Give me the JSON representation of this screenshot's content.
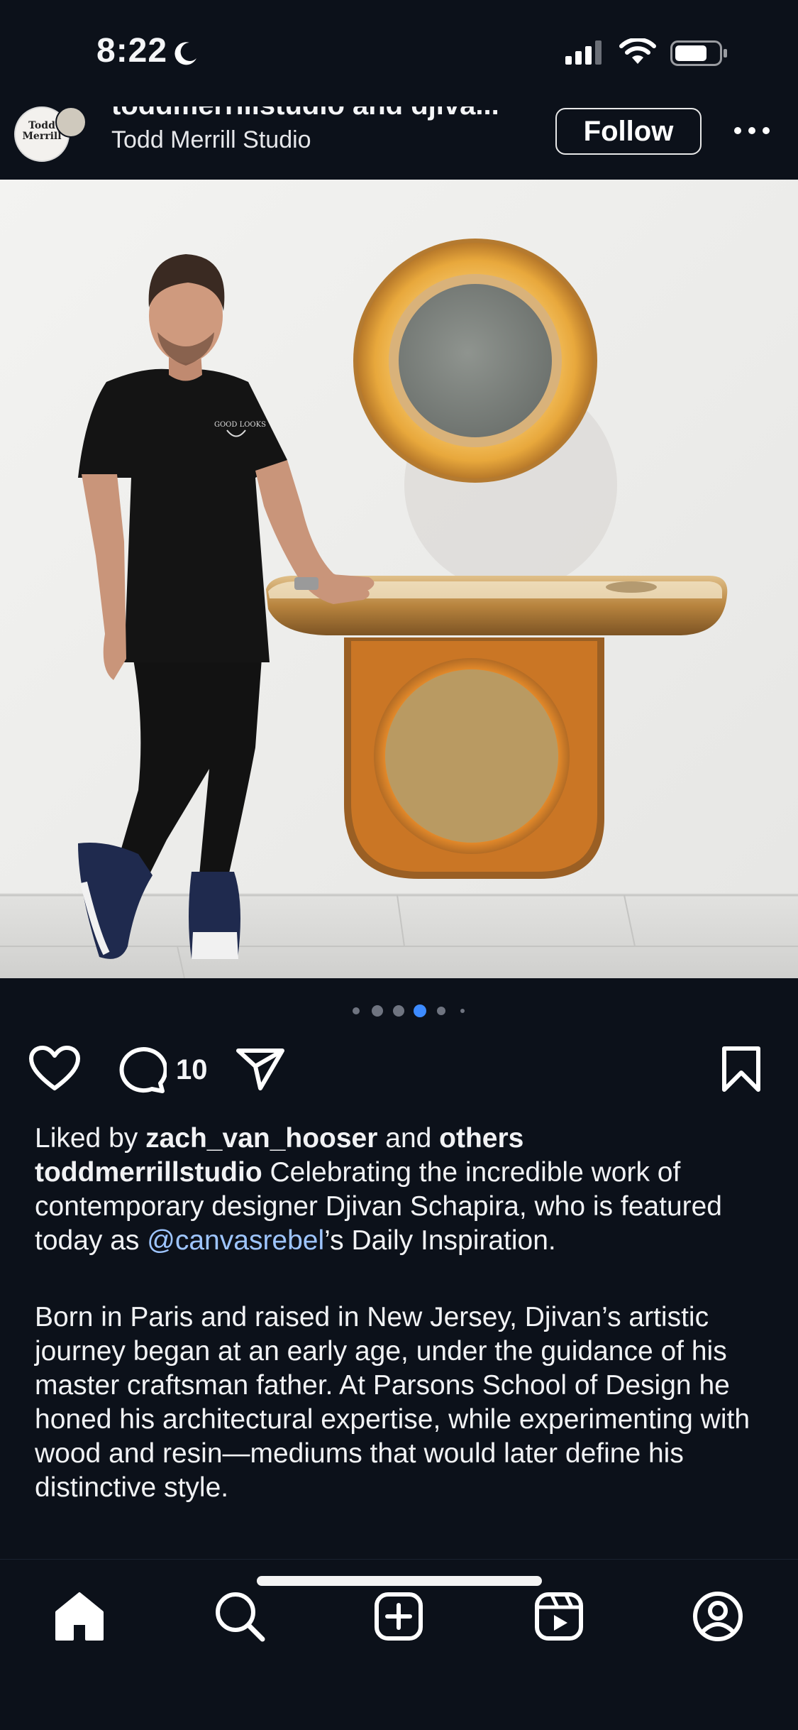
{
  "status": {
    "time": "8:22"
  },
  "post": {
    "collab_line_visible": "toddmerrillstudio and djiva...",
    "author_name": "Todd Merrill Studio",
    "avatar_text": "Todd Merrill",
    "follow_label": "Follow",
    "photo_description_text": "GOOD LOOKS"
  },
  "pager": {
    "count": 6,
    "active_index": 3
  },
  "actions": {
    "comment_count": "10"
  },
  "caption": {
    "liked_by_prefix": "Liked by ",
    "liked_by_user": "zach_van_hooser",
    "liked_by_and": " and ",
    "liked_by_others": "others",
    "username": "toddmerrillstudio",
    "text_part1": " Celebrating the incredible work of contemporary designer Djivan Schapira, who is featured today as ",
    "mention": "@canvasrebel",
    "text_part2": "’s Daily Inspiration.",
    "paragraph2": "Born in Paris and raised in New Jersey, Djivan’s artistic journey began at an early age, under the guidance of his master craftsman father. At Parsons School of Design he honed his architectural expertise, while experimenting with wood and resin—mediums that would later define his distinctive style."
  },
  "colors": {
    "background": "#0c111a",
    "text": "#f4f5f7",
    "mention": "#9ec5ff",
    "pager_active": "#3d8bff"
  },
  "tabs": [
    "home-icon",
    "search-icon",
    "create-icon",
    "reels-icon",
    "profile-icon"
  ]
}
